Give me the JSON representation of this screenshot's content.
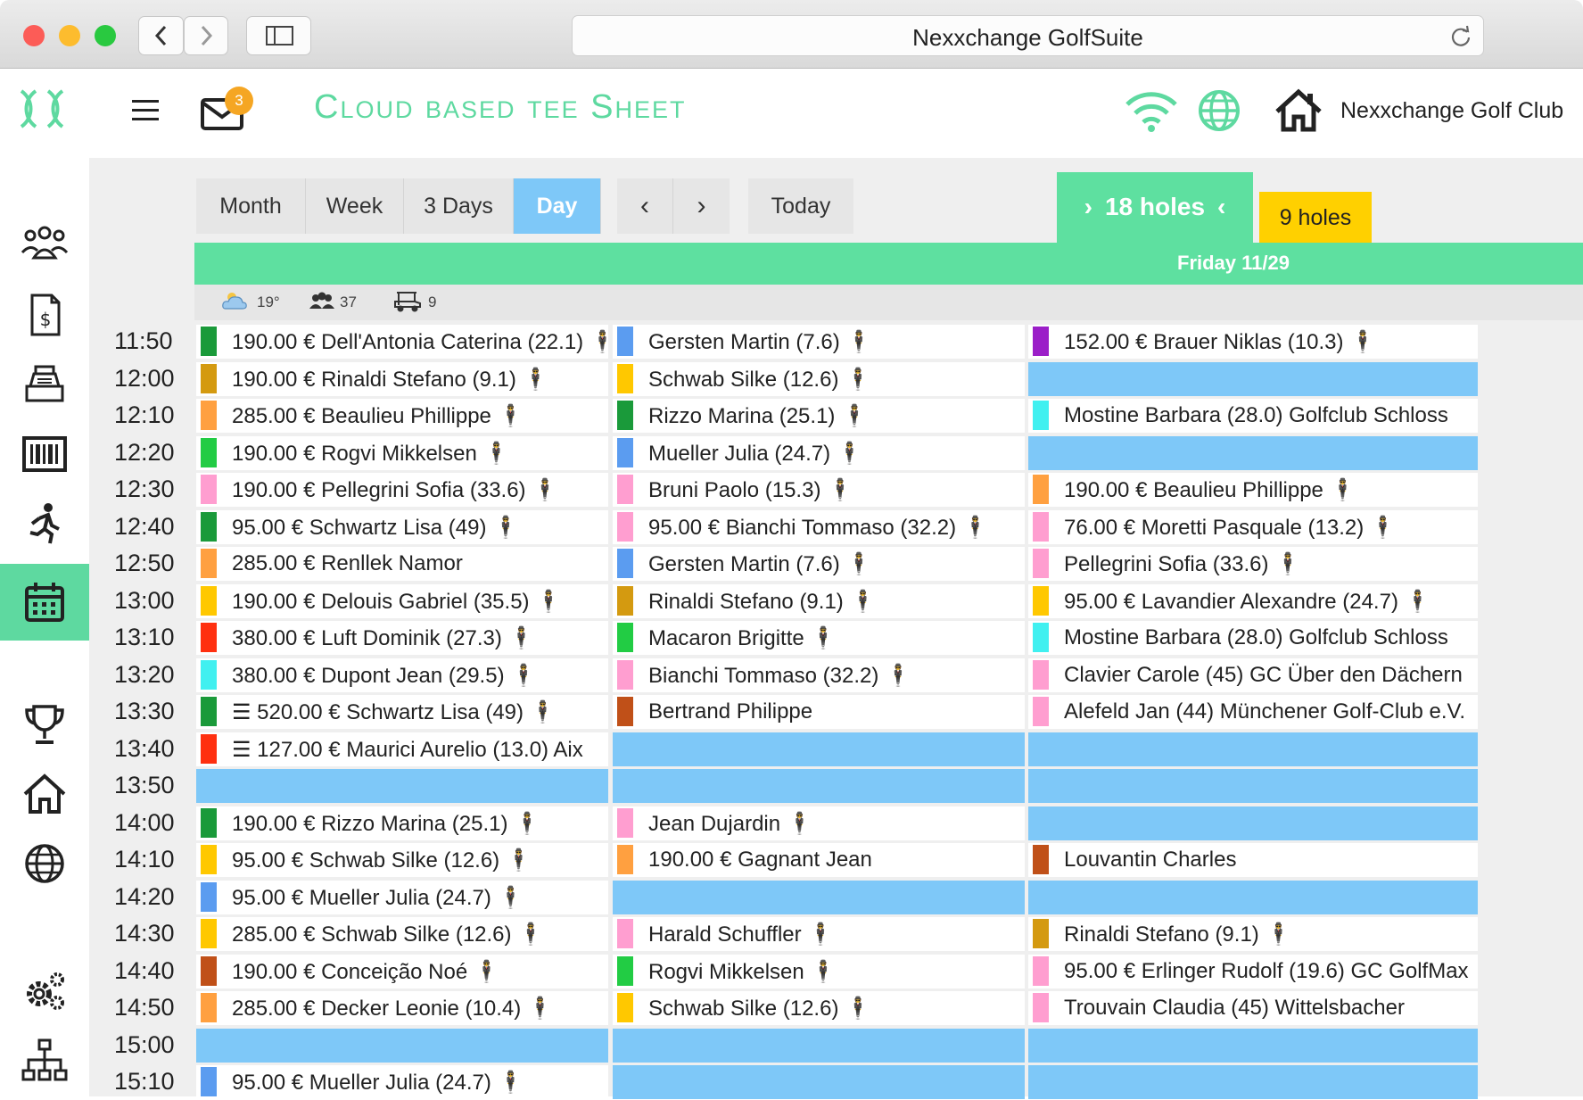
{
  "browser": {
    "url_title": "Nexxchange GolfSuite"
  },
  "header": {
    "app_title": "Cloud based tee Sheet",
    "mail_badge": "3",
    "club_name": "Nexxchange Golf Club"
  },
  "toolbar": {
    "views": [
      "Month",
      "Week",
      "3 Days",
      "Day"
    ],
    "active_view": "Day",
    "prev": "‹",
    "next": "›",
    "today": "Today",
    "holes18": "18 holes",
    "holes9": "9 holes"
  },
  "day_header": {
    "date": "Friday 11/29",
    "weather": "19°",
    "players": "37",
    "carts": "9"
  },
  "colors": {
    "accent_green": "#5ed9a0",
    "empty_slot": "#7ec8f8",
    "nine_holes": "#ffd000"
  },
  "rows": [
    {
      "time": "11:50",
      "cells": [
        {
          "color": "#1a9a3a",
          "text": "190.00 € Dell'Antonia Caterina (22.1) 🕴"
        },
        {
          "color": "#5b9cf0",
          "text": "Gersten Martin (7.6) 🕴"
        },
        {
          "color": "#9b1ec8",
          "text": "152.00 € Brauer Niklas (10.3) 🕴"
        }
      ]
    },
    {
      "time": "12:00",
      "cells": [
        {
          "color": "#d49a10",
          "text": "190.00 € Rinaldi Stefano (9.1) 🕴"
        },
        {
          "color": "#ffc800",
          "text": "Schwab Silke (12.6) 🕴"
        },
        {
          "color": null,
          "text": ""
        }
      ]
    },
    {
      "time": "12:10",
      "cells": [
        {
          "color": "#ffa040",
          "text": "285.00 € Beaulieu Phillippe 🕴"
        },
        {
          "color": "#1a9a3a",
          "text": "Rizzo Marina (25.1) 🕴"
        },
        {
          "color": "#40f0f0",
          "text": "Mostine Barbara (28.0) Golfclub Schloss"
        }
      ]
    },
    {
      "time": "12:20",
      "cells": [
        {
          "color": "#22cc44",
          "text": "190.00 € Rogvi Mikkelsen 🕴"
        },
        {
          "color": "#5b9cf0",
          "text": "Mueller Julia (24.7) 🕴"
        },
        {
          "color": null,
          "text": ""
        }
      ]
    },
    {
      "time": "12:30",
      "cells": [
        {
          "color": "#ff9ed0",
          "text": "190.00 € Pellegrini Sofia (33.6) 🕴"
        },
        {
          "color": "#ff9ed0",
          "text": "Bruni Paolo (15.3) 🕴"
        },
        {
          "color": "#ffa040",
          "text": "190.00 € Beaulieu Phillippe 🕴"
        }
      ]
    },
    {
      "time": "12:40",
      "cells": [
        {
          "color": "#1a9a3a",
          "text": "95.00 € Schwartz Lisa (49) 🕴"
        },
        {
          "color": "#ff9ed0",
          "text": "95.00 € Bianchi Tommaso (32.2) 🕴"
        },
        {
          "color": "#ff9ed0",
          "text": "76.00 € Moretti Pasquale (13.2) 🕴"
        }
      ]
    },
    {
      "time": "12:50",
      "cells": [
        {
          "color": "#ffa040",
          "text": "285.00 € Renllek Namor"
        },
        {
          "color": "#5b9cf0",
          "text": "Gersten Martin (7.6) 🕴"
        },
        {
          "color": "#ff9ed0",
          "text": "Pellegrini Sofia (33.6) 🕴"
        }
      ]
    },
    {
      "time": "13:00",
      "cells": [
        {
          "color": "#ffc800",
          "text": "190.00 € Delouis Gabriel (35.5) 🕴"
        },
        {
          "color": "#d49a10",
          "text": "Rinaldi Stefano (9.1) 🕴"
        },
        {
          "color": "#ffc800",
          "text": "95.00 € Lavandier Alexandre (24.7) 🕴"
        }
      ]
    },
    {
      "time": "13:10",
      "cells": [
        {
          "color": "#ff3010",
          "text": "380.00 € Luft Dominik (27.3) 🕴"
        },
        {
          "color": "#22cc44",
          "text": "Macaron Brigitte 🕴"
        },
        {
          "color": "#40f0f0",
          "text": "Mostine Barbara (28.0) Golfclub Schloss"
        }
      ]
    },
    {
      "time": "13:20",
      "cells": [
        {
          "color": "#40f0f0",
          "text": "380.00 € Dupont Jean (29.5) 🕴"
        },
        {
          "color": "#ff9ed0",
          "text": "Bianchi Tommaso (32.2) 🕴"
        },
        {
          "color": "#ff9ed0",
          "text": "Clavier Carole (45) GC Über den Dächern"
        }
      ]
    },
    {
      "time": "13:30",
      "cells": [
        {
          "color": "#1a9a3a",
          "text": "☰ 520.00 € Schwartz Lisa (49) 🕴"
        },
        {
          "color": "#c05018",
          "text": "Bertrand Philippe"
        },
        {
          "color": "#ff9ed0",
          "text": "Alefeld Jan (44) Münchener Golf-Club e.V."
        }
      ]
    },
    {
      "time": "13:40",
      "cells": [
        {
          "color": "#ff3010",
          "text": "☰ 127.00 € Maurici Aurelio (13.0) Aix"
        },
        {
          "color": null,
          "text": ""
        },
        {
          "color": null,
          "text": ""
        }
      ]
    },
    {
      "time": "13:50",
      "cells": [
        {
          "color": null,
          "text": ""
        },
        {
          "color": null,
          "text": ""
        },
        {
          "color": null,
          "text": ""
        }
      ]
    },
    {
      "time": "14:00",
      "cells": [
        {
          "color": "#1a9a3a",
          "text": "190.00 € Rizzo Marina (25.1) 🕴"
        },
        {
          "color": "#ff9ed0",
          "text": "Jean Dujardin 🕴"
        },
        {
          "color": null,
          "text": ""
        }
      ]
    },
    {
      "time": "14:10",
      "cells": [
        {
          "color": "#ffc800",
          "text": "95.00 € Schwab Silke (12.6) 🕴"
        },
        {
          "color": "#ffa040",
          "text": "190.00 € Gagnant Jean"
        },
        {
          "color": "#c05018",
          "text": "Louvantin Charles"
        }
      ]
    },
    {
      "time": "14:20",
      "cells": [
        {
          "color": "#5b9cf0",
          "text": "95.00 € Mueller Julia (24.7) 🕴"
        },
        {
          "color": null,
          "text": ""
        },
        {
          "color": null,
          "text": ""
        }
      ]
    },
    {
      "time": "14:30",
      "cells": [
        {
          "color": "#ffc800",
          "text": "285.00 € Schwab Silke (12.6) 🕴"
        },
        {
          "color": "#ff9ed0",
          "text": "Harald Schuffler 🕴"
        },
        {
          "color": "#d49a10",
          "text": "Rinaldi Stefano (9.1) 🕴"
        }
      ]
    },
    {
      "time": "14:40",
      "cells": [
        {
          "color": "#c05018",
          "text": "190.00 € Conceição Noé 🕴"
        },
        {
          "color": "#22cc44",
          "text": "Rogvi Mikkelsen 🕴"
        },
        {
          "color": "#ff9ed0",
          "text": "95.00 € Erlinger Rudolf (19.6) GC GolfMax"
        }
      ]
    },
    {
      "time": "14:50",
      "cells": [
        {
          "color": "#ffa040",
          "text": "285.00 € Decker Leonie (10.4) 🕴"
        },
        {
          "color": "#ffc800",
          "text": "Schwab Silke (12.6) 🕴"
        },
        {
          "color": "#ff9ed0",
          "text": "Trouvain Claudia (45) Wittelsbacher"
        }
      ]
    },
    {
      "time": "15:00",
      "cells": [
        {
          "color": null,
          "text": ""
        },
        {
          "color": null,
          "text": ""
        },
        {
          "color": null,
          "text": ""
        }
      ]
    },
    {
      "time": "15:10",
      "cells": [
        {
          "color": "#5b9cf0",
          "text": "95.00 € Mueller Julia (24.7) 🕴"
        },
        {
          "color": null,
          "text": ""
        },
        {
          "color": null,
          "text": ""
        }
      ]
    }
  ]
}
